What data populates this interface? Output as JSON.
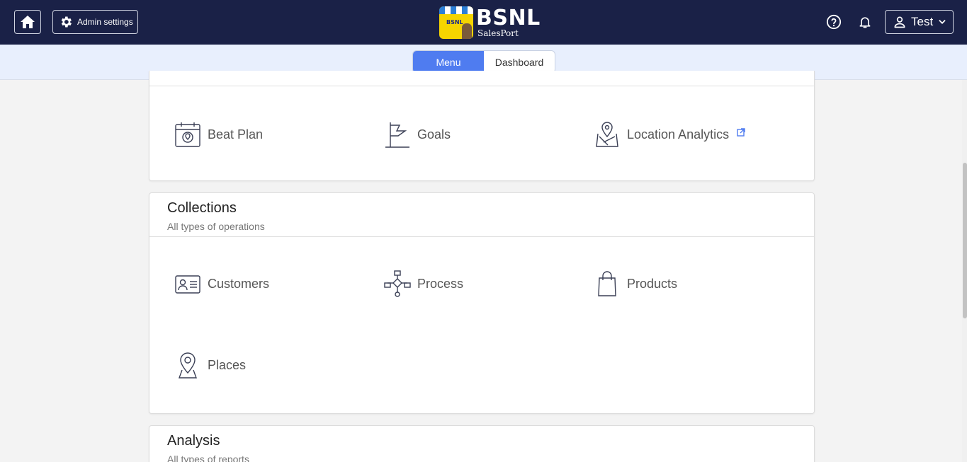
{
  "header": {
    "admin_label": "Admin settings",
    "logo_text": "BSNL",
    "logo_sub": "SalesPort",
    "logo_badge": "BSNL",
    "user_name": "Test"
  },
  "view_toggle": {
    "menu_label": "Menu",
    "dashboard_label": "Dashboard",
    "selected": "Menu"
  },
  "section_top": {
    "items": [
      {
        "label": "Beat Plan",
        "icon": "calendar-icon"
      },
      {
        "label": "Goals",
        "icon": "flag-icon"
      },
      {
        "label": "Location Analytics",
        "icon": "map-pin-icon",
        "external": true
      }
    ]
  },
  "collections": {
    "title": "Collections",
    "subtitle": "All types of operations",
    "items": [
      {
        "label": "Customers",
        "icon": "id-card-icon"
      },
      {
        "label": "Process",
        "icon": "flowchart-icon"
      },
      {
        "label": "Products",
        "icon": "shopping-bag-icon"
      },
      {
        "label": "Places",
        "icon": "location-pin-icon"
      }
    ]
  },
  "analysis": {
    "title": "Analysis",
    "subtitle": "All types of reports"
  },
  "colors": {
    "topbar": "#1a2147",
    "accent": "#4f7cf0",
    "subbar": "#e8effd"
  }
}
